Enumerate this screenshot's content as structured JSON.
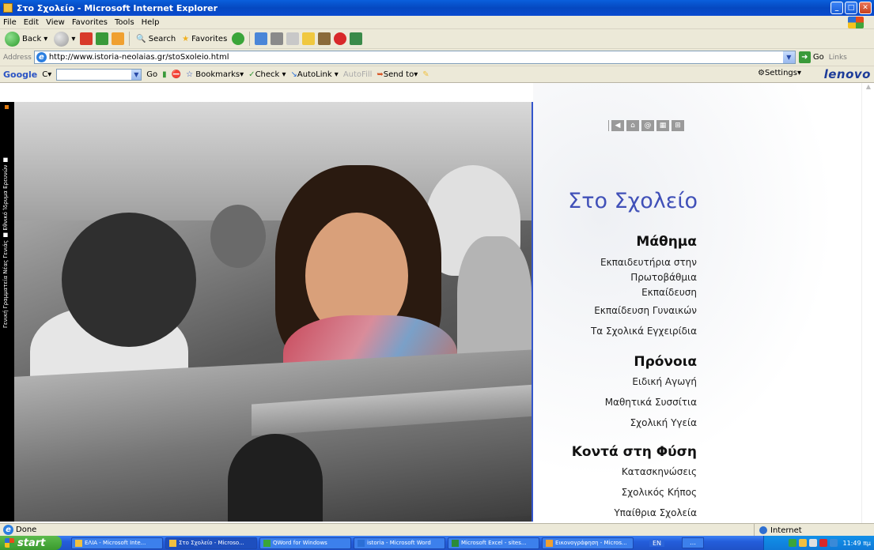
{
  "window": {
    "title": "Στο Σχολείο - Microsoft Internet Explorer"
  },
  "menu": [
    "File",
    "Edit",
    "View",
    "Favorites",
    "Tools",
    "Help"
  ],
  "toolbar": {
    "back_label": "Back",
    "search_label": "Search",
    "favorites_label": "Favorites"
  },
  "address": {
    "label": "Address",
    "url": "http://www.istoria-neolaias.gr/stoSxoleio.html",
    "go_label": "Go",
    "links_label": "Links"
  },
  "googlebar": {
    "logo": "Google",
    "search_prefix": "C",
    "go_label": "Go",
    "bookmarks_label": "Bookmarks",
    "check_label": "Check",
    "autolink_label": "AutoLink",
    "autofill_label": "AutoFill",
    "sendto_label": "Send to",
    "settings_label": "Settings",
    "brand": "lenovo"
  },
  "sidebar": {
    "vertical_text": "Γενική Γραμματεία Νέας Γενιάς ■ Εθνικό Ίδρυμα Ερευνών ■",
    "colors": {
      "top_mark": "#e07b10",
      "mid_mark": "#3fa53a"
    }
  },
  "page": {
    "title": "Στο Σχολείο",
    "title_color": "#4050b8",
    "sections": [
      {
        "heading": "Μάθημα",
        "links": [
          "Εκπαιδευτήρια στην Πρωτοβάθμια Εκπαίδευση",
          "Εκπαίδευση Γυναικών",
          "Τα Σχολικά Εγχειρίδια"
        ]
      },
      {
        "heading": "Πρόνοια",
        "links": [
          "Ειδική Αγωγή",
          "Μαθητικά Συσσίτια",
          "Σχολική Υγεία"
        ]
      },
      {
        "heading": "Κοντά στη Φύση",
        "links": [
          "Κατασκηνώσεις",
          "Σχολικός Κήπος",
          "Υπαίθρια Σχολεία"
        ]
      }
    ],
    "nav_icons": [
      "back-icon",
      "home-icon",
      "email-icon",
      "sitemap-icon",
      "expand-icon"
    ]
  },
  "status": {
    "text": "Done",
    "zone": "Internet"
  },
  "taskbar": {
    "start_label": "start",
    "tasks": [
      "ΕΛΙΑ - Microsoft Inte...",
      "Στο Σχολείο - Microso...",
      "QWord for Windows",
      "istoria - Microsoft Word",
      "Microsoft Excel - sites...",
      "Εικονογράφηση - Micros..."
    ],
    "language": "EN",
    "clock": "11:49 πμ"
  }
}
